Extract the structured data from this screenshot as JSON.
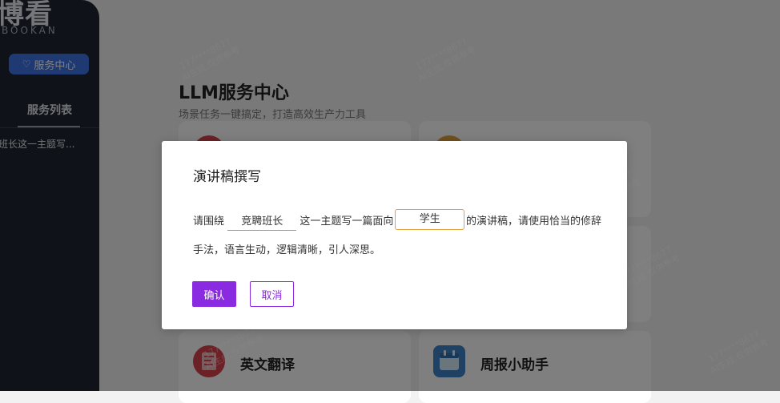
{
  "sidebar": {
    "logo_main": "博看",
    "logo_sub": "BOOKAN",
    "service_button": "服务中心",
    "list_title": "服务列表",
    "list_item": "班长这一主题写..."
  },
  "main": {
    "title": "LLM服务中心",
    "subtitle": "场景任务一键搞定，打造高效生产力工具",
    "cards": [
      {
        "title": "英文翻译"
      },
      {
        "title": "周报小助手"
      }
    ]
  },
  "watermark": {
    "line1": "177****8677",
    "line2": "AI生成,仅供参考"
  },
  "dialog": {
    "title": "演讲稿撰写",
    "text_before": "请围绕",
    "field1": "竞聘班长",
    "text_middle": "这一主题写一篇面向",
    "field2": "学生",
    "text_after": "的演讲稿，请使用恰当的修辞",
    "text_line2": "手法，语言生动，逻辑清晰，引人深思。",
    "confirm_label": "确认",
    "cancel_label": "取消"
  },
  "colors": {
    "accent": "#8a2be2",
    "sidebar_bg": "#1f2430",
    "service_button": "#3e73e6",
    "field_highlight": "#e6a23c"
  },
  "icons": [
    "heart-icon",
    "translate-app-icon",
    "weekly-report-app-icon"
  ]
}
